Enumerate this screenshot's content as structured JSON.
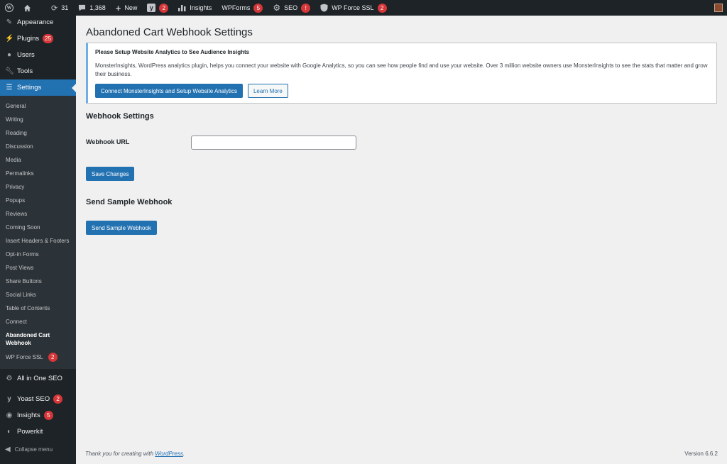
{
  "adminbar": {
    "updates_count": "31",
    "comments_count": "1,368",
    "new_label": "New",
    "yoast_badge": "2",
    "insights_label": "Insights",
    "wpforms_label": "WPForms",
    "wpforms_badge": "5",
    "seo_label": "SEO",
    "seo_badge": "!",
    "ssl_label": "WP Force SSL",
    "ssl_badge": "2"
  },
  "sidebar": {
    "appearance": "Appearance",
    "plugins": "Plugins",
    "plugins_badge": "25",
    "users": "Users",
    "tools": "Tools",
    "settings": "Settings",
    "submenu": [
      "General",
      "Writing",
      "Reading",
      "Discussion",
      "Media",
      "Permalinks",
      "Privacy",
      "Popups",
      "Reviews",
      "Coming Soon",
      "Insert Headers & Footers",
      "Opt-in Forms",
      "Post Views",
      "Share Buttons",
      "Social Links",
      "Table of Contents",
      "Connect",
      "Abandoned Cart Webhook",
      "WP Force SSL"
    ],
    "ssl_sub_badge": "2",
    "aioseo": "All in One SEO",
    "yoast": "Yoast SEO",
    "yoast_badge": "2",
    "insights": "Insights",
    "insights_badge": "5",
    "powerkit": "Powerkit",
    "collapse": "Collapse menu"
  },
  "main": {
    "title": "Abandoned Cart Webhook Settings",
    "notice": {
      "title": "Please Setup Website Analytics to See Audience Insights",
      "text": "MonsterInsights, WordPress analytics plugin, helps you connect your website with Google Analytics, so you can see how people find and use your website. Over 3 million website owners use MonsterInsights to see the stats that matter and grow their business.",
      "primary_button": "Connect MonsterInsights and Setup Website Analytics",
      "secondary_button": "Learn More"
    },
    "webhook_heading": "Webhook Settings",
    "webhook_label": "Webhook URL",
    "webhook_value": "",
    "save_button": "Save Changes",
    "sample_heading": "Send Sample Webhook",
    "sample_button": "Send Sample Webhook"
  },
  "footer": {
    "thanks_prefix": "Thank you for creating with",
    "thanks_link": "WordPress",
    "thanks_suffix": ".",
    "version": "Version 6.6.2"
  },
  "colors": {
    "accent": "#2271b1",
    "adminbar_bg": "#1d2327",
    "badge": "#d63638",
    "notice_border": "#72aee6"
  }
}
